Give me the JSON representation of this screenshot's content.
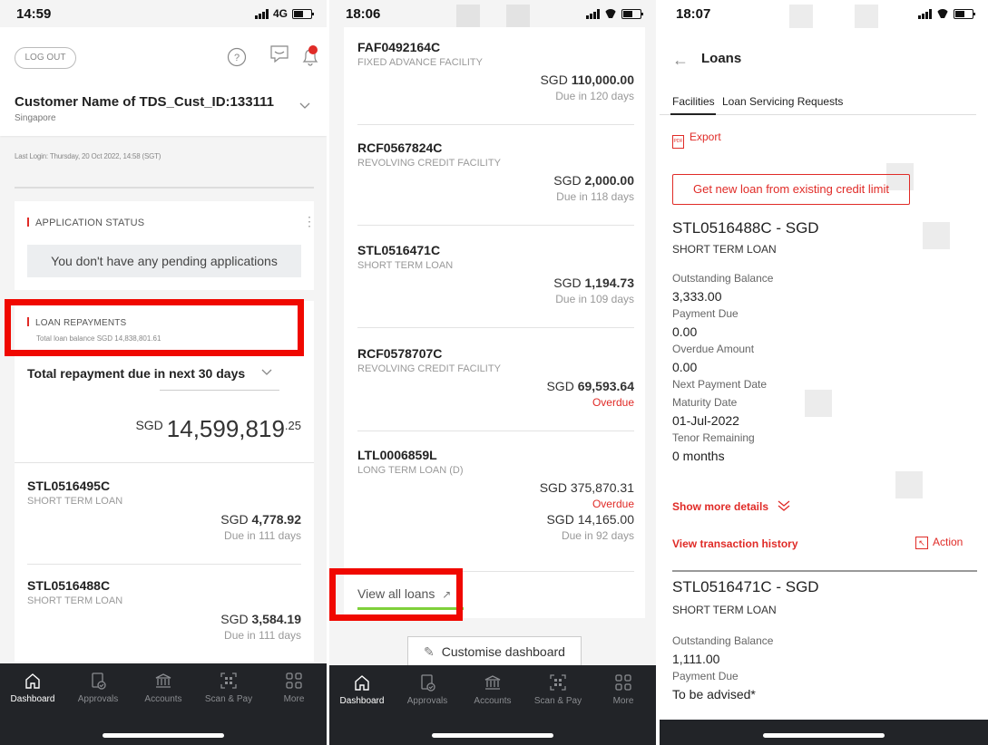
{
  "screen1": {
    "time": "14:59",
    "network": "4G",
    "logout_label": "LOG OUT",
    "customer_name": "Customer Name of TDS_Cust_ID:133111",
    "country": "Singapore",
    "last_login": "Last Login: Thursday, 20 Oct 2022, 14:58 (SGT)",
    "application_status_title": "APPLICATION STATUS",
    "no_pending": "You don't have any pending applications",
    "loan_repayments_title": "LOAN REPAYMENTS",
    "total_loan_balance": "Total loan balance SGD 14,838,801.61",
    "repayment_dropdown": "Total repayment due in next 30 days",
    "total_currency": "SGD",
    "total_amount_main": "14,599,819",
    "total_amount_cents": ".25",
    "loans": [
      {
        "code": "STL0516495C",
        "type": "SHORT TERM LOAN",
        "currency": "SGD",
        "amount": "4,778.92",
        "due": "Due in 111 days"
      },
      {
        "code": "STL0516488C",
        "type": "SHORT TERM LOAN",
        "currency": "SGD",
        "amount": "3,584.19",
        "due": "Due in 111 days"
      }
    ]
  },
  "screen2": {
    "time": "18:06",
    "loans": [
      {
        "code": "FAF0492164C",
        "type": "FIXED ADVANCE FACILITY",
        "currency": "SGD",
        "amount": "110,000.00",
        "status": "Due in 120 days"
      },
      {
        "code": "RCF0567824C",
        "type": "REVOLVING CREDIT FACILITY",
        "currency": "SGD",
        "amount": "2,000.00",
        "status": "Due in 118 days"
      },
      {
        "code": "STL0516471C",
        "type": "SHORT TERM LOAN",
        "currency": "SGD",
        "amount": "1,194.73",
        "status": "Due in 109 days"
      },
      {
        "code": "RCF0578707C",
        "type": "REVOLVING CREDIT FACILITY",
        "currency": "SGD",
        "amount": "69,593.64",
        "status": "Overdue"
      },
      {
        "code": "LTL0006859L",
        "type": "LONG TERM LOAN (D)",
        "currency": "SGD",
        "amount": "375,870.31",
        "status": "Overdue",
        "currency2": "SGD",
        "amount2": "14,165.00",
        "status2": "Due in 92 days"
      }
    ],
    "view_all_loans": "View all loans",
    "customise_dashboard": "Customise dashboard"
  },
  "screen3": {
    "time": "18:07",
    "title": "Loans",
    "tabs": [
      "Facilities",
      "Loan Servicing Requests"
    ],
    "export_label": "Export",
    "get_new_loan": "Get new loan from existing credit limit",
    "loan1": {
      "heading": "STL0516488C - SGD",
      "type": "SHORT TERM LOAN",
      "outstanding_label": "Outstanding Balance",
      "outstanding": "3,333.00",
      "payment_due_label": "Payment Due",
      "payment_due": "0.00",
      "overdue_label": "Overdue Amount",
      "overdue": "0.00",
      "next_payment_label": "Next Payment Date",
      "maturity_label": "Maturity Date",
      "maturity": "01-Jul-2022",
      "tenor_label": "Tenor Remaining",
      "tenor": "0 months"
    },
    "show_more": "Show more details",
    "view_history": "View transaction history",
    "action": "Action",
    "loan2": {
      "heading": "STL0516471C - SGD",
      "type": "SHORT TERM LOAN",
      "outstanding_label": "Outstanding Balance",
      "outstanding": "1,111.00",
      "payment_due_label": "Payment Due",
      "payment_due": "To be advised*"
    }
  },
  "nav": {
    "items": [
      "Dashboard",
      "Approvals",
      "Accounts",
      "Scan & Pay",
      "More"
    ]
  },
  "colors": {
    "accent_red": "#e02b27",
    "highlight_red": "#f00800",
    "nav_bg": "#222428"
  }
}
